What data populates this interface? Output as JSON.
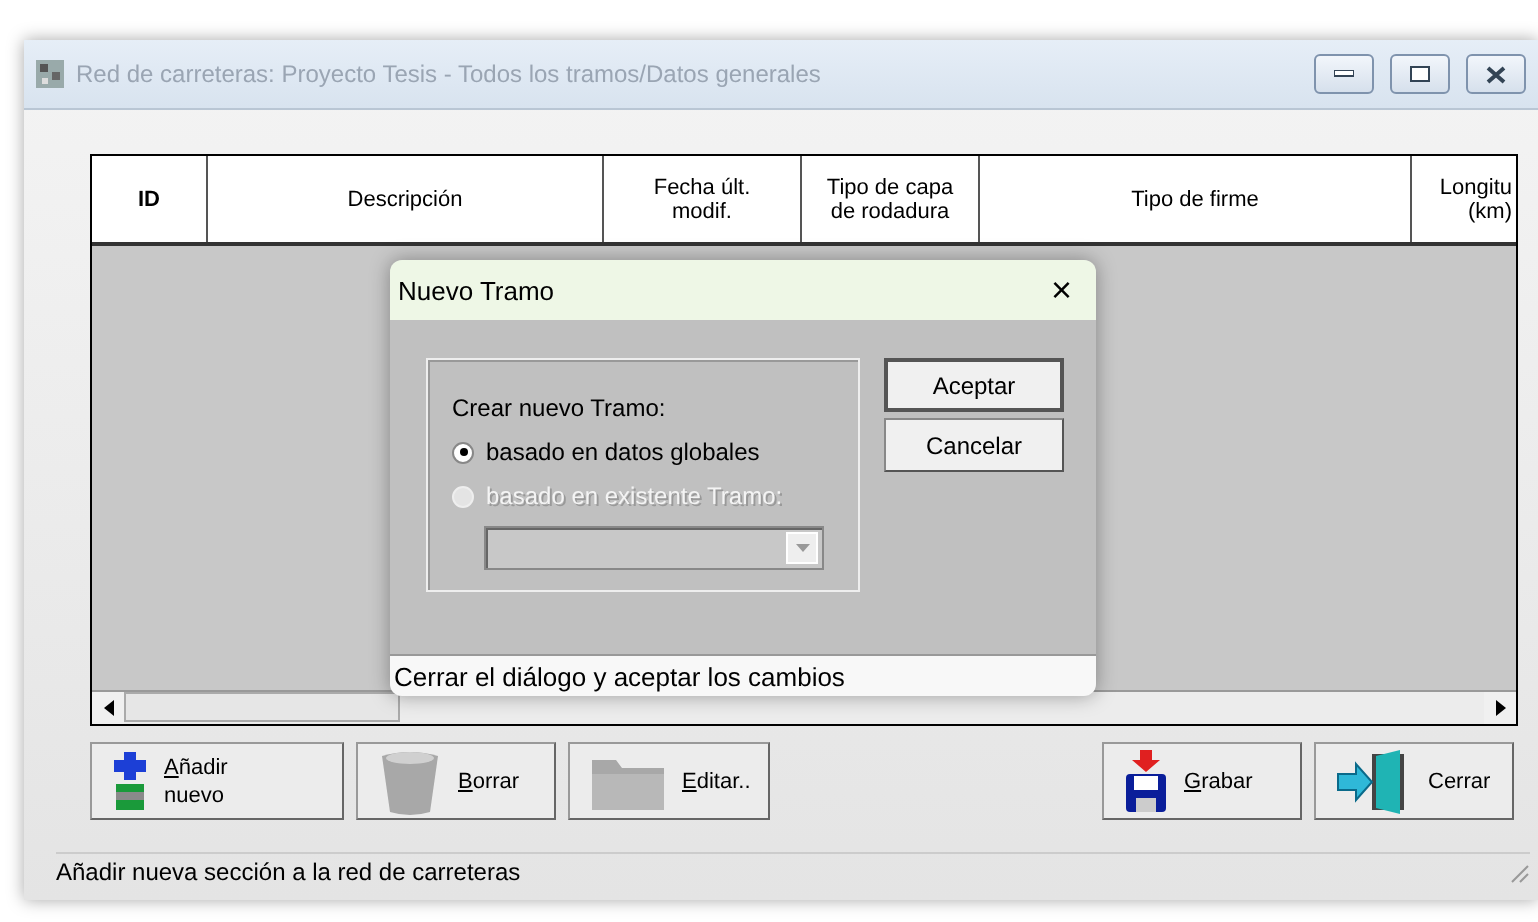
{
  "window": {
    "title": "Red de carreteras: Proyecto Tesis - Todos los tramos/Datos generales"
  },
  "table": {
    "columns": [
      {
        "label": "ID",
        "bold": true
      },
      {
        "label": "Descripción",
        "bold": false
      },
      {
        "label": "Fecha últ.\nmodif.",
        "bold": false
      },
      {
        "label": "Tipo de capa\nde rodadura",
        "bold": false
      },
      {
        "label": "Tipo de firme",
        "bold": false
      },
      {
        "label": "Longitu\n(km)",
        "bold": false
      }
    ]
  },
  "buttons": [
    {
      "kind": "add",
      "label": "Añadir\nnuevo",
      "mnemonic": true,
      "disabled": false
    },
    {
      "kind": "delete",
      "label": "Borrar",
      "mnemonic": true,
      "disabled": true
    },
    {
      "kind": "edit",
      "label": "Editar..",
      "mnemonic": true,
      "disabled": true
    },
    {
      "kind": "save",
      "label": "Grabar",
      "mnemonic": true,
      "disabled": false
    },
    {
      "kind": "exit",
      "label": "Cerrar",
      "mnemonic": false,
      "disabled": false
    }
  ],
  "status_bar": "Añadir nueva sección a la red de carreteras",
  "dialog": {
    "title": "Nuevo Tramo",
    "close": "×",
    "group_label": "Crear nuevo Tramo:",
    "options": [
      {
        "label": "basado en datos globales",
        "selected": true,
        "disabled": false
      },
      {
        "label": "basado en existente Tramo:",
        "selected": false,
        "disabled": true
      }
    ],
    "combo": {
      "disabled": true
    },
    "buttons": [
      {
        "label": "Aceptar",
        "default": true
      },
      {
        "label": "Cancelar",
        "default": false
      }
    ],
    "status": "Cerrar el diálogo y aceptar los cambios"
  }
}
